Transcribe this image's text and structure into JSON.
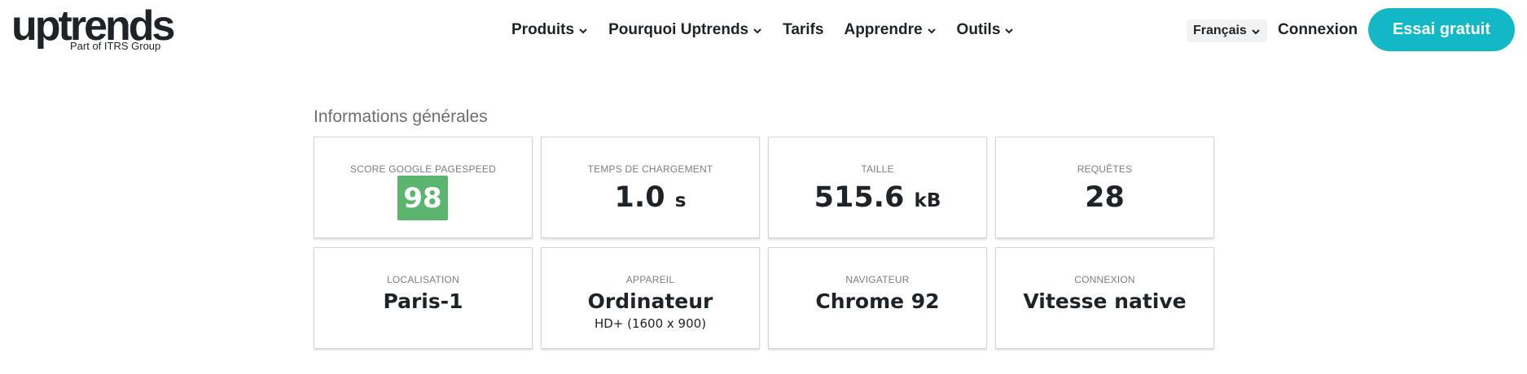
{
  "brand": {
    "name": "uptrends",
    "tagline": "Part of ITRS Group"
  },
  "nav": {
    "items": [
      {
        "label": "Produits",
        "has_dropdown": true
      },
      {
        "label": "Pourquoi Uptrends",
        "has_dropdown": true
      },
      {
        "label": "Tarifs",
        "has_dropdown": false
      },
      {
        "label": "Apprendre",
        "has_dropdown": true
      },
      {
        "label": "Outils",
        "has_dropdown": true
      }
    ],
    "language": "Français",
    "login": "Connexion",
    "cta": "Essai gratuit"
  },
  "section": {
    "title": "Informations générales"
  },
  "cards": {
    "score": {
      "label": "Score Google PageSpeed",
      "value": "98"
    },
    "load_time": {
      "label": "Temps de chargement",
      "value": "1.0",
      "unit": "s"
    },
    "size": {
      "label": "Taille",
      "value": "515.6",
      "unit": "kB"
    },
    "requests": {
      "label": "Requêtes",
      "value": "28"
    },
    "location": {
      "label": "Localisation",
      "value": "Paris-1"
    },
    "device": {
      "label": "Appareil",
      "value": "Ordinateur",
      "sub": "HD+ (1600 x 900)"
    },
    "browser": {
      "label": "Navigateur",
      "value": "Chrome 92"
    },
    "connection": {
      "label": "Connexion",
      "value": "Vitesse native"
    }
  },
  "colors": {
    "accent": "#12b8c5",
    "score_good": "#5cb56e",
    "text": "#1d2327"
  }
}
